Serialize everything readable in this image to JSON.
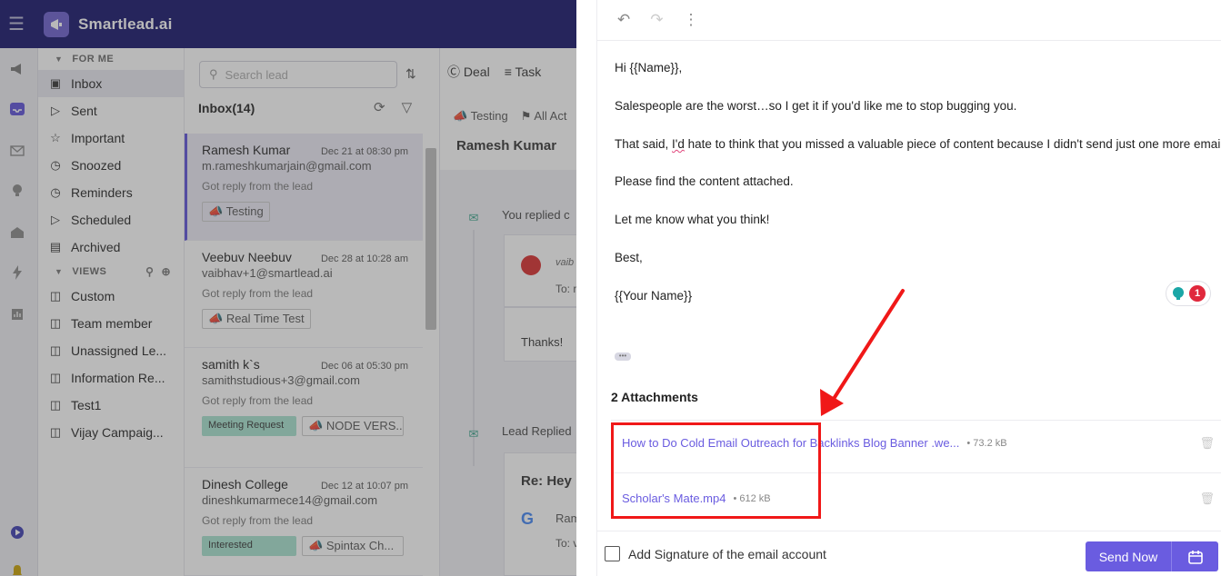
{
  "header": {
    "brand": "Smartlead.ai"
  },
  "sidebar": {
    "for_me_label": "FOR ME",
    "views_label": "VIEWS",
    "items": [
      {
        "label": "Inbox",
        "icon": "inbox-icon"
      },
      {
        "label": "Sent",
        "icon": "send-icon"
      },
      {
        "label": "Important",
        "icon": "star-icon"
      },
      {
        "label": "Snoozed",
        "icon": "clock-icon"
      },
      {
        "label": "Reminders",
        "icon": "alarm-icon"
      },
      {
        "label": "Scheduled",
        "icon": "schedule-send-icon"
      },
      {
        "label": "Archived",
        "icon": "archive-icon"
      }
    ],
    "views": [
      {
        "label": "Custom"
      },
      {
        "label": "Team member"
      },
      {
        "label": "Unassigned Le..."
      },
      {
        "label": "Information Re..."
      },
      {
        "label": "Test1"
      },
      {
        "label": "Vijay Campaig..."
      }
    ]
  },
  "list": {
    "search_placeholder": "Search lead",
    "title": "Inbox(14)",
    "leads": [
      {
        "name": "Ramesh Kumar",
        "date": "Dec 21 at 08:30 pm",
        "email": "m.rameshkumarjain@gmail.com",
        "sub": "Got reply from the lead",
        "tags": [
          "Testing"
        ]
      },
      {
        "name": "Veebuv Neebuv",
        "date": "Dec 28 at 10:28 am",
        "email": "vaibhav+1@smartlead.ai",
        "sub": "Got reply from the lead",
        "tags": [
          "Real Time Test"
        ]
      },
      {
        "name": "samith k`s",
        "date": "Dec 06 at 05:30 pm",
        "email": "samithstudious+3@gmail.com",
        "sub": "Got reply from the lead",
        "tags": [
          "Meeting Request",
          "NODE VERS..."
        ]
      },
      {
        "name": "Dinesh College",
        "date": "Dec 12 at 10:07 pm",
        "email": "dineshkumarmece14@gmail.com",
        "sub": "Got reply from the lead",
        "tags": [
          "Interested",
          "Spintax Ch..."
        ]
      }
    ]
  },
  "thread": {
    "tabs": [
      "Deal",
      "Task"
    ],
    "subtabs": [
      "Testing",
      "All Act"
    ],
    "lead_name": "Ramesh Kumar",
    "event1": "You replied c",
    "event1_from": "vaib",
    "event1_to": "To: r",
    "event1_body": "Thanks!",
    "event2": "Lead Replied",
    "event2_subject": "Re: Hey",
    "event2_from": "Ram",
    "event2_to": "To: v"
  },
  "composer": {
    "body": {
      "greeting": "Hi {{Name}},",
      "line1": "Salespeople are the worst…so I get it if you'd like me to stop bugging you.",
      "line2_pre": "That said, ",
      "line2_spell": "I'd",
      "line2_post": " hate to think that you missed a valuable piece of content because I didn't send just one more email.",
      "line3": "Please find the content attached.",
      "line4": "Let me know what you think!",
      "signoff": "Best,",
      "signature": "{{Your Name}}"
    },
    "attachments_title": "2 Attachments",
    "attachments": [
      {
        "name": "How to Do Cold Email Outreach for Backlinks Blog Banner .we...",
        "size": "• 73.2 kB"
      },
      {
        "name": "Scholar's Mate.mp4",
        "size": "• 612 kB"
      }
    ],
    "assistant_badge": "1",
    "signature_checkbox_label": "Add Signature of the email account",
    "send_label": "Send Now"
  },
  "colors": {
    "accent": "#6a5ce0",
    "nav": "#12116a",
    "annotation": "#f01818"
  }
}
